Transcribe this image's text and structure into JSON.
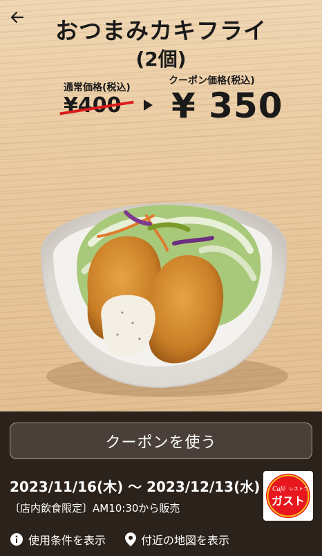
{
  "header": {
    "title": "おつまみカキフライ",
    "subtitle": "(2個)"
  },
  "pricing": {
    "regular_label": "通常価格(税込)",
    "regular_price": "¥400",
    "coupon_label": "クーポン価格(税込)",
    "coupon_price": "¥ 350"
  },
  "actions": {
    "use_coupon": "クーポンを使う"
  },
  "validity": {
    "period": "2023/11/16(木) 〜 2023/12/13(水)",
    "note": "〔店内飲食限定〕AM10:30から販売"
  },
  "brand": {
    "cafe_text": "Café",
    "restaurant_text": "レストラン",
    "name": "ガスト",
    "color": "#e8161d"
  },
  "links": {
    "terms": "使用条件を表示",
    "map": "付近の地図を表示"
  },
  "icons": {
    "back": "arrow-left-icon",
    "terms": "info-icon",
    "map": "location-pin-icon"
  }
}
